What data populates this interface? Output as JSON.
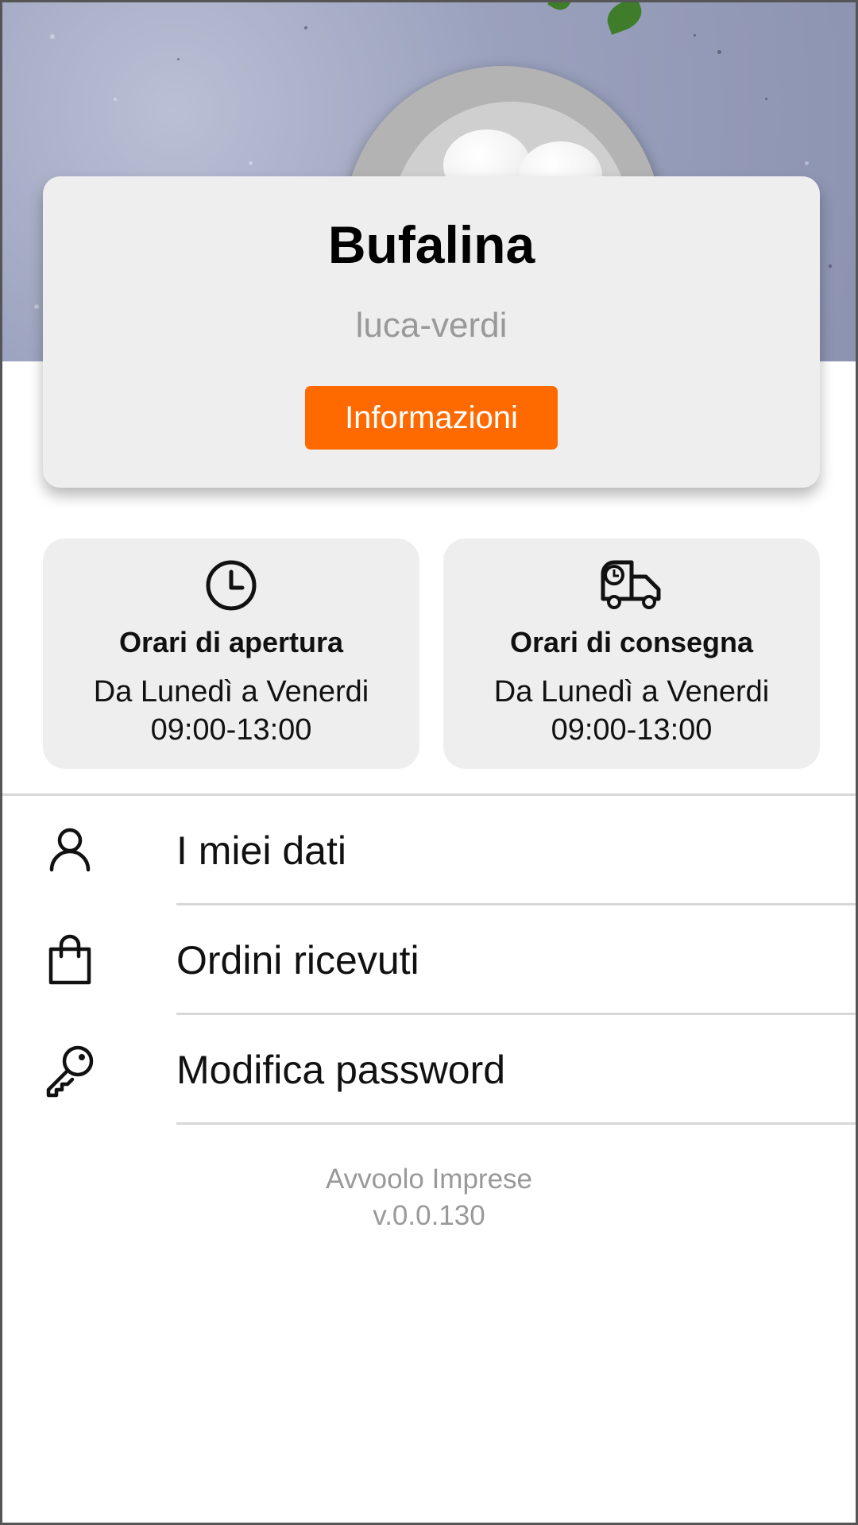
{
  "store": {
    "name": "Bufalina",
    "username": "luca-verdi",
    "info_button": "Informazioni"
  },
  "hours": {
    "opening": {
      "icon": "clock-icon",
      "title": "Orari di apertura",
      "days": "Da Lunedì a Venerdi",
      "time": "09:00-13:00"
    },
    "delivery": {
      "icon": "delivery-truck-icon",
      "title": "Orari di consegna",
      "days": "Da Lunedì a Venerdi",
      "time": "09:00-13:00"
    }
  },
  "menu": {
    "items": [
      {
        "icon": "user-icon",
        "label": "I miei dati"
      },
      {
        "icon": "shopping-bag-icon",
        "label": "Ordini ricevuti"
      },
      {
        "icon": "key-icon",
        "label": "Modifica password"
      }
    ]
  },
  "footer": {
    "app_name": "Avvoolo Imprese",
    "version": "v.0.0.130"
  },
  "colors": {
    "accent": "#ff6a00",
    "card_bg": "#eeeeee",
    "muted_text": "#999999"
  }
}
